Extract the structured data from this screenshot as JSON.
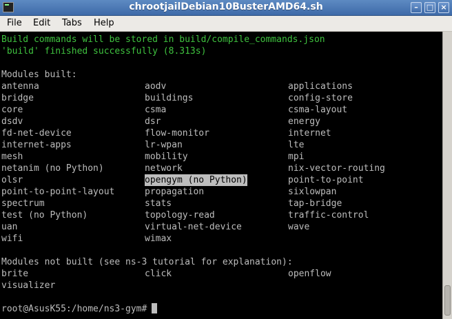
{
  "window": {
    "title": "chrootjailDebian10BusterAMD64.sh"
  },
  "menu": {
    "file": "File",
    "edit": "Edit",
    "tabs": "Tabs",
    "help": "Help"
  },
  "terminal": {
    "build_msg": "Build commands will be stored in build/compile_commands.json",
    "finished_msg": "'build' finished successfully (8.313s)",
    "modules_built_header": "Modules built:",
    "modules_built": [
      [
        "antenna",
        "aodv",
        "applications"
      ],
      [
        "bridge",
        "buildings",
        "config-store"
      ],
      [
        "core",
        "csma",
        "csma-layout"
      ],
      [
        "dsdv",
        "dsr",
        "energy"
      ],
      [
        "fd-net-device",
        "flow-monitor",
        "internet"
      ],
      [
        "internet-apps",
        "lr-wpan",
        "lte"
      ],
      [
        "mesh",
        "mobility",
        "mpi"
      ],
      [
        "netanim (no Python)",
        "network",
        "nix-vector-routing"
      ],
      [
        "olsr",
        "opengym (no Python)",
        "point-to-point"
      ],
      [
        "point-to-point-layout",
        "propagation",
        "sixlowpan"
      ],
      [
        "spectrum",
        "stats",
        "tap-bridge"
      ],
      [
        "test (no Python)",
        "topology-read",
        "traffic-control"
      ],
      [
        "uan",
        "virtual-net-device",
        "wave"
      ],
      [
        "wifi",
        "wimax",
        ""
      ]
    ],
    "highlighted_module": "opengym (no Python)",
    "modules_not_built_header": "Modules not built (see ns-3 tutorial for explanation):",
    "modules_not_built": [
      [
        "brite",
        "click",
        "openflow"
      ],
      [
        "visualizer",
        "",
        ""
      ]
    ],
    "prompt": "root@AsusK55:/home/ns3-gym#"
  },
  "colors": {
    "text": "#bdbdbd",
    "green_text": "#3fc23f",
    "background": "#000000",
    "titlebar": "#4a76b2"
  },
  "icons": {
    "app": "terminal-icon",
    "minimize": "minimize-icon",
    "maximize": "maximize-icon",
    "close": "close-icon"
  }
}
